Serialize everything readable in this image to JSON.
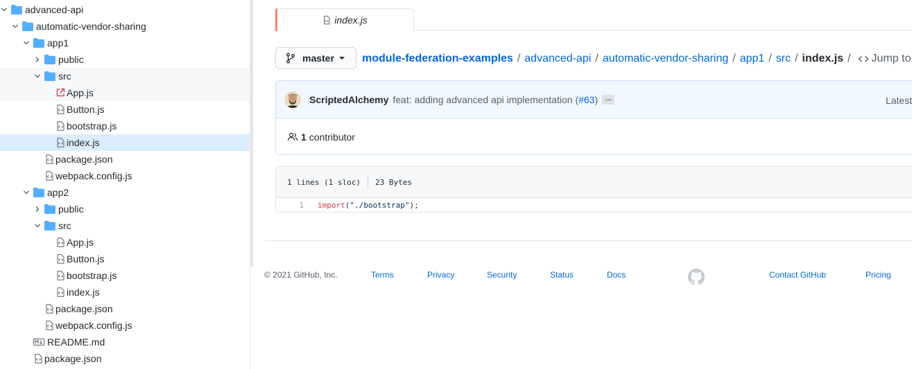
{
  "tree": {
    "rows": [
      {
        "label": "advanced-api",
        "kind": "folder",
        "depth": 0,
        "open": true
      },
      {
        "label": "automatic-vendor-sharing",
        "kind": "folder",
        "depth": 1,
        "open": true
      },
      {
        "label": "app1",
        "kind": "folder",
        "depth": 2,
        "open": true
      },
      {
        "label": "public",
        "kind": "folder",
        "depth": 3,
        "open": false
      },
      {
        "label": "src",
        "kind": "folder",
        "depth": 3,
        "open": true,
        "highlight": true
      },
      {
        "label": "App.js",
        "kind": "file-link",
        "depth": 4,
        "highlight": true
      },
      {
        "label": "Button.js",
        "kind": "file",
        "depth": 4
      },
      {
        "label": "bootstrap.js",
        "kind": "file",
        "depth": 4
      },
      {
        "label": "index.js",
        "kind": "file",
        "depth": 4,
        "selected": true
      },
      {
        "label": "package.json",
        "kind": "file",
        "depth": 3
      },
      {
        "label": "webpack.config.js",
        "kind": "file",
        "depth": 3
      },
      {
        "label": "app2",
        "kind": "folder",
        "depth": 2,
        "open": true
      },
      {
        "label": "public",
        "kind": "folder",
        "depth": 3,
        "open": false
      },
      {
        "label": "src",
        "kind": "folder",
        "depth": 3,
        "open": true
      },
      {
        "label": "App.js",
        "kind": "file",
        "depth": 4
      },
      {
        "label": "Button.js",
        "kind": "file",
        "depth": 4
      },
      {
        "label": "bootstrap.js",
        "kind": "file",
        "depth": 4
      },
      {
        "label": "index.js",
        "kind": "file",
        "depth": 4
      },
      {
        "label": "package.json",
        "kind": "file",
        "depth": 3
      },
      {
        "label": "webpack.config.js",
        "kind": "file",
        "depth": 3
      },
      {
        "label": "README.md",
        "kind": "markdown",
        "depth": 2
      },
      {
        "label": "package.json",
        "kind": "file",
        "depth": 2
      }
    ]
  },
  "tab": {
    "label": "index.js"
  },
  "branch": {
    "label": "master"
  },
  "breadcrumb": {
    "repo": "module-federation-examples",
    "segments": [
      "advanced-api",
      "automatic-vendor-sharing",
      "app1",
      "src"
    ],
    "file": "index.js",
    "jump_label": "Jump to"
  },
  "commit": {
    "author": "ScriptedAlchemy",
    "message": "feat: adding advanced api implementation (",
    "pr": "#63",
    "message_end": ")",
    "ellipsis": "…",
    "latest": "Latest c"
  },
  "contributors": {
    "count": "1",
    "label": "contributor"
  },
  "file": {
    "lines": "1 lines (1 sloc)",
    "size": "23 Bytes",
    "code": [
      {
        "num": "1",
        "kw": "import",
        "open": "(",
        "str": "\"./bootstrap\"",
        "close": ");"
      }
    ]
  },
  "footer": {
    "copyright": "© 2021 GitHub, Inc.",
    "links": [
      "Terms",
      "Privacy",
      "Security",
      "Status",
      "Docs",
      "Contact GitHub",
      "Pricing"
    ]
  },
  "colors": {
    "accent": "#0366d6",
    "selected": "#dbedff",
    "folder": "#54aeff",
    "tab_accent": "#f9826c"
  }
}
